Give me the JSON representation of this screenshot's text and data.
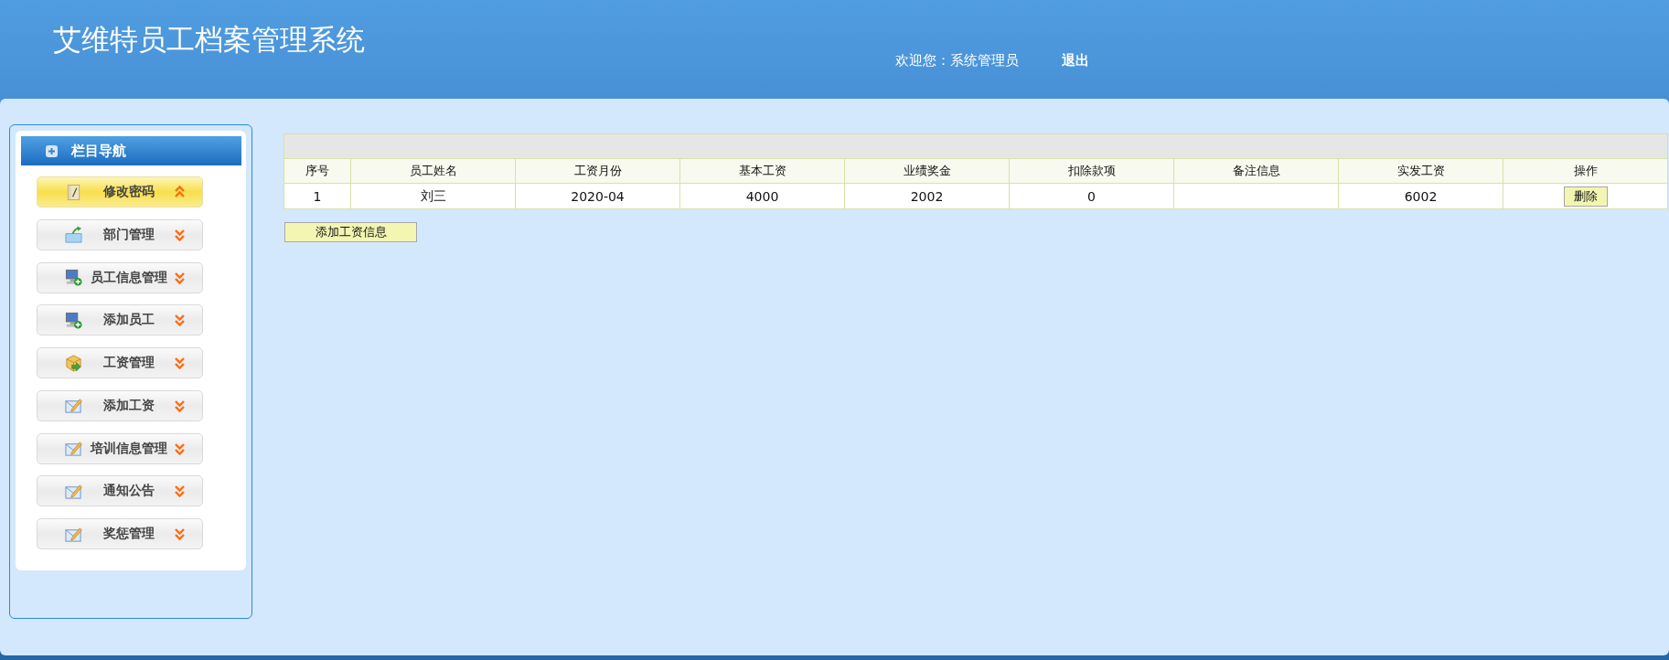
{
  "header": {
    "title": "艾维特员工档案管理系统",
    "welcome": "欢迎您：系统管理员",
    "logout": "退出"
  },
  "sidebar": {
    "title": "栏目导航",
    "items": [
      {
        "label": "修改密码",
        "selected": true
      },
      {
        "label": "部门管理",
        "selected": false
      },
      {
        "label": "员工信息管理",
        "selected": false
      },
      {
        "label": "添加员工",
        "selected": false
      },
      {
        "label": "工资管理",
        "selected": false
      },
      {
        "label": "添加工资",
        "selected": false
      },
      {
        "label": "培训信息管理",
        "selected": false
      },
      {
        "label": "通知公告",
        "selected": false
      },
      {
        "label": "奖惩管理",
        "selected": false
      }
    ]
  },
  "table": {
    "columns": [
      "序号",
      "员工姓名",
      "工资月份",
      "基本工资",
      "业绩奖金",
      "扣除款项",
      "备注信息",
      "实发工资",
      "操作"
    ],
    "rows": [
      {
        "cells": [
          "1",
          "刘三",
          "2020-04",
          "4000",
          "2002",
          "0",
          null,
          "6002"
        ],
        "action": "删除"
      }
    ]
  },
  "add_button": "添加工资信息"
}
